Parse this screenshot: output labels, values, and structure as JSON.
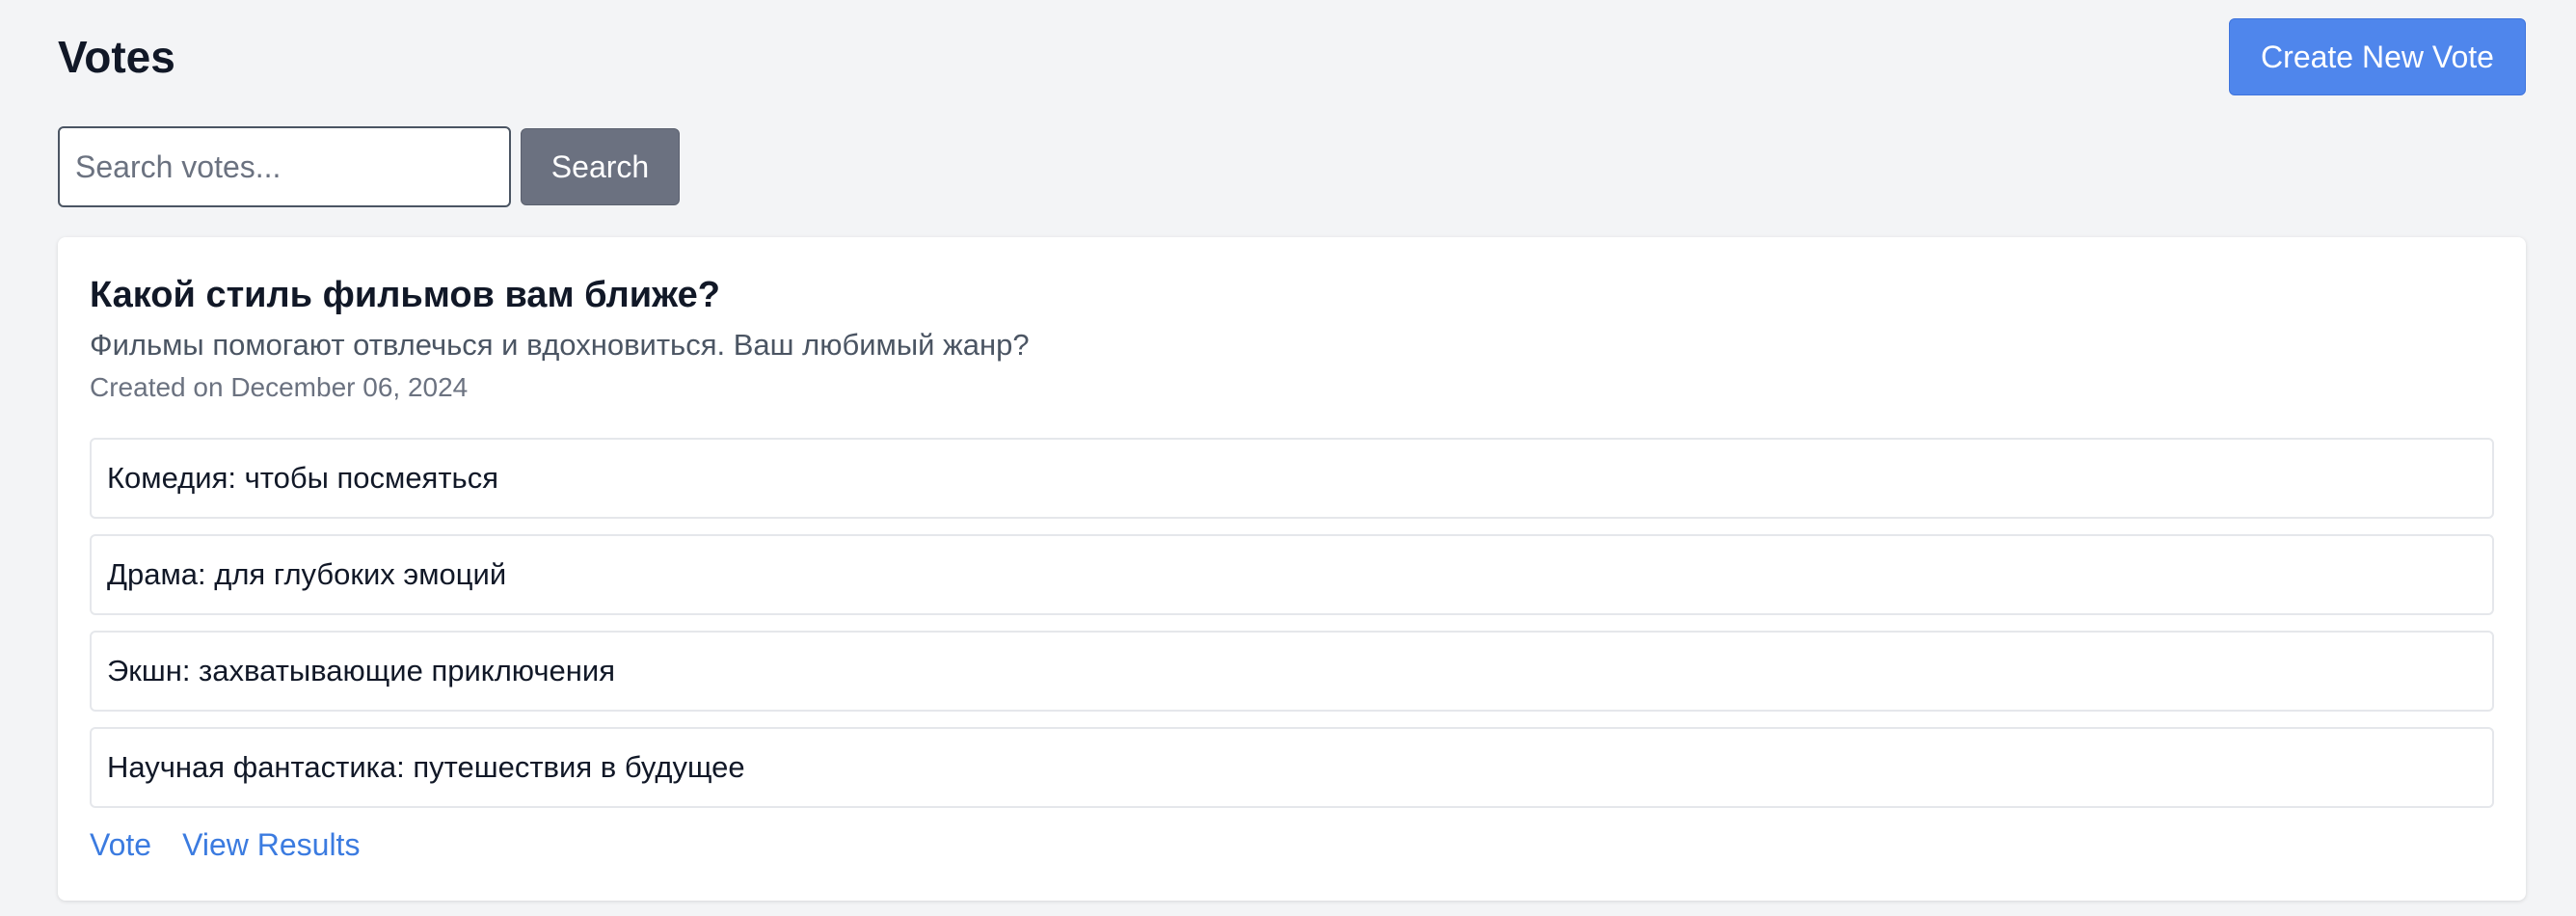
{
  "header": {
    "title": "Votes",
    "create_button_label": "Create New Vote"
  },
  "search": {
    "placeholder": "Search votes...",
    "value": "",
    "button_label": "Search"
  },
  "votes": [
    {
      "title": "Какой стиль фильмов вам ближе?",
      "description": "Фильмы помогают отвлечься и вдохновиться. Ваш любимый жанр?",
      "created": "Created on December 06, 2024",
      "options": [
        "Комедия: чтобы посмеяться",
        "Драма: для глубоких эмоций",
        "Экшн: захватывающие приключения",
        "Научная фантастика: путешествия в будущее"
      ],
      "vote_link": "Vote",
      "results_link": "View Results"
    }
  ],
  "colors": {
    "background": "#f3f4f6",
    "primary": "#4f86ec",
    "secondary": "#6b7180",
    "link": "#3b7be0"
  }
}
